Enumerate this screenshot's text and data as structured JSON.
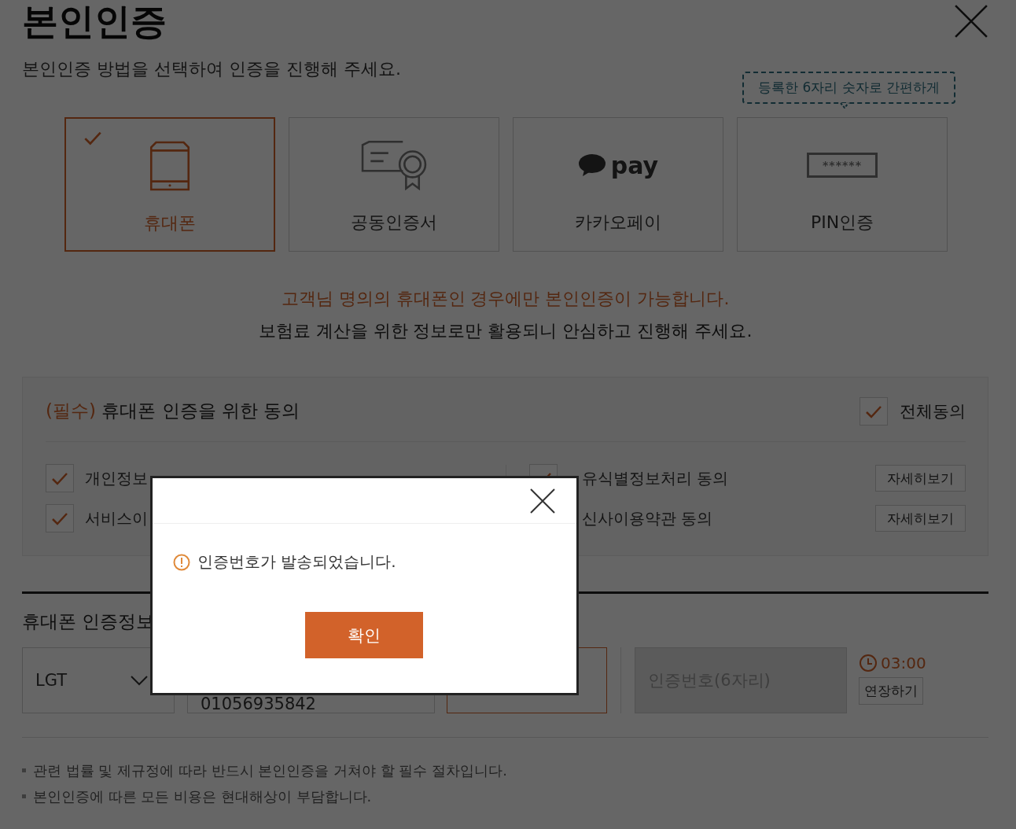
{
  "page": {
    "title": "본인인증",
    "subtitle": "본인인증 방법을 선택하여 인증을 진행해 주세요."
  },
  "methods": [
    {
      "kind": "phone",
      "label": "휴대폰",
      "selected": true
    },
    {
      "kind": "certificate",
      "label": "공동인증서",
      "selected": false
    },
    {
      "kind": "pay",
      "label": "카카오페이",
      "logo_text": "pay",
      "selected": false
    },
    {
      "kind": "pin",
      "label": "PIN인증",
      "icon_text": "******",
      "tooltip": "등록한 6자리 숫자로 간편하게",
      "selected": false
    }
  ],
  "notice": {
    "highlight": "고객님 명의의 휴대폰인 경우에만 본인인증이 가능합니다.",
    "text": "보험료 계산을 위한 정보로만 활용되니 안심하고 진행해 주세요."
  },
  "consent": {
    "required_tag": "(필수)",
    "title": "휴대폰 인증을 위한 동의",
    "all": {
      "label": "전체동의",
      "checked": true
    },
    "items": [
      {
        "label": "개인정보",
        "checked": true
      },
      {
        "label": "유식별정보처리 동의",
        "checked": true,
        "detail_button": "자세히보기"
      },
      {
        "label": "서비스이",
        "checked": true
      },
      {
        "label": "신사이용약관 동의",
        "detail_button": "자세히보기"
      }
    ]
  },
  "auth": {
    "title": "휴대폰 인증정보",
    "carrier": {
      "value": "LGT"
    },
    "phone": {
      "value": "01056935842"
    },
    "request_field": {
      "focused": true
    },
    "code": {
      "placeholder": "인증번호(6자리)"
    },
    "timer": "03:00",
    "extend_button": "연장하기"
  },
  "notes": [
    "관련 법률 및 제규정에 따라 반드시 본인인증을 거쳐야 할 필수 절차입니다.",
    "본인인증에 따른 모든 비용은 현대해상이 부담합니다."
  ],
  "dialog": {
    "message": "인증번호가 발송되었습니다.",
    "confirm_button": "확인"
  }
}
